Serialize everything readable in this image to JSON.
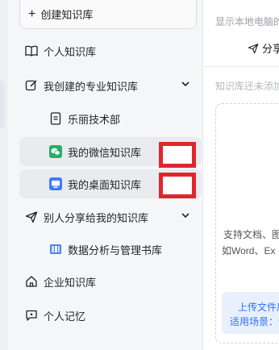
{
  "sidebar": {
    "create_button": "创建知识库",
    "items": [
      {
        "label": "个人知识库",
        "icon": "book-icon"
      },
      {
        "label": "我创建的专业知识库",
        "icon": "edit-icon",
        "expanded": true
      },
      {
        "label": "乐丽技术部",
        "icon": "document-icon"
      },
      {
        "label": "我的微信知识库",
        "icon": "wechat-icon",
        "selected": true
      },
      {
        "label": "我的桌面知识库",
        "icon": "desktop-icon",
        "selected": true
      },
      {
        "label": "别人分享给我的知识库",
        "icon": "share-icon",
        "expanded": true
      },
      {
        "label": "数据分析与管理书库",
        "icon": "library-icon"
      },
      {
        "label": "企业知识库",
        "icon": "home-icon"
      },
      {
        "label": "个人记忆",
        "icon": "memory-icon"
      }
    ]
  },
  "main": {
    "top_hint": "显示本地电脑的",
    "share_label": "分享",
    "empty_hint": "知识库还未添加",
    "desc_line1": "支持文档、图",
    "desc_line2": "如Word、Ex",
    "info_line1": "上传文件后",
    "info_line2": "适用场景：论"
  },
  "colors": {
    "annotation_red": "#e0262d",
    "accent_blue": "#3370ff",
    "wechat_green": "#2aae67",
    "desktop_blue": "#3d7bf5"
  }
}
